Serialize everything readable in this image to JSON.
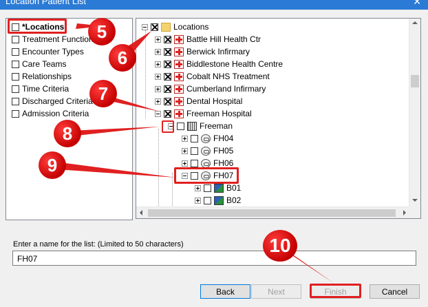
{
  "window": {
    "title": "Location Patient List",
    "close_glyph": "✕"
  },
  "options": [
    {
      "label": "*Locations",
      "checked": false,
      "bold": true
    },
    {
      "label": "Treatment Function",
      "checked": false
    },
    {
      "label": "Encounter Types",
      "checked": false
    },
    {
      "label": "Care Teams",
      "checked": false
    },
    {
      "label": "Relationships",
      "checked": false
    },
    {
      "label": "Time Criteria",
      "checked": false
    },
    {
      "label": "Discharged Criteria",
      "checked": false
    },
    {
      "label": "Admission Criteria",
      "checked": false
    }
  ],
  "tree": {
    "root": {
      "label": "Locations",
      "icon": "folder-icon",
      "expanded": true,
      "checked": "x"
    },
    "sites": [
      {
        "label": "Battle Hill Health Ctr",
        "icon": "hospital-icon"
      },
      {
        "label": "Berwick Infirmary",
        "icon": "hospital-icon"
      },
      {
        "label": "Biddlestone Health Centre",
        "icon": "hospital-icon"
      },
      {
        "label": "Cobalt NHS Treatment",
        "icon": "hospital-icon"
      },
      {
        "label": "Cumberland Infirmary",
        "icon": "hospital-icon"
      },
      {
        "label": "Dental Hospital",
        "icon": "hospital-icon"
      },
      {
        "label": "Freeman Hospital",
        "icon": "hospital-icon"
      }
    ],
    "building": {
      "label": "Freeman",
      "icon": "building-icon"
    },
    "wards": [
      {
        "label": "FH04",
        "icon": "ward-icon"
      },
      {
        "label": "FH05",
        "icon": "ward-icon"
      },
      {
        "label": "FH06",
        "icon": "ward-icon"
      },
      {
        "label": "FH07",
        "icon": "ward-icon"
      }
    ],
    "beds": [
      {
        "label": "B01",
        "icon": "bed-icon"
      },
      {
        "label": "B02",
        "icon": "bed-icon"
      }
    ]
  },
  "name_field": {
    "label": "Enter a name for the list: (Limited to 50 characters)",
    "value": "FH07"
  },
  "buttons": {
    "back": "Back",
    "next": "Next",
    "finish": "Finish",
    "cancel": "Cancel"
  },
  "annotations": {
    "steps": [
      "5",
      "6",
      "7",
      "8",
      "9",
      "10"
    ],
    "color": "#e02020"
  }
}
